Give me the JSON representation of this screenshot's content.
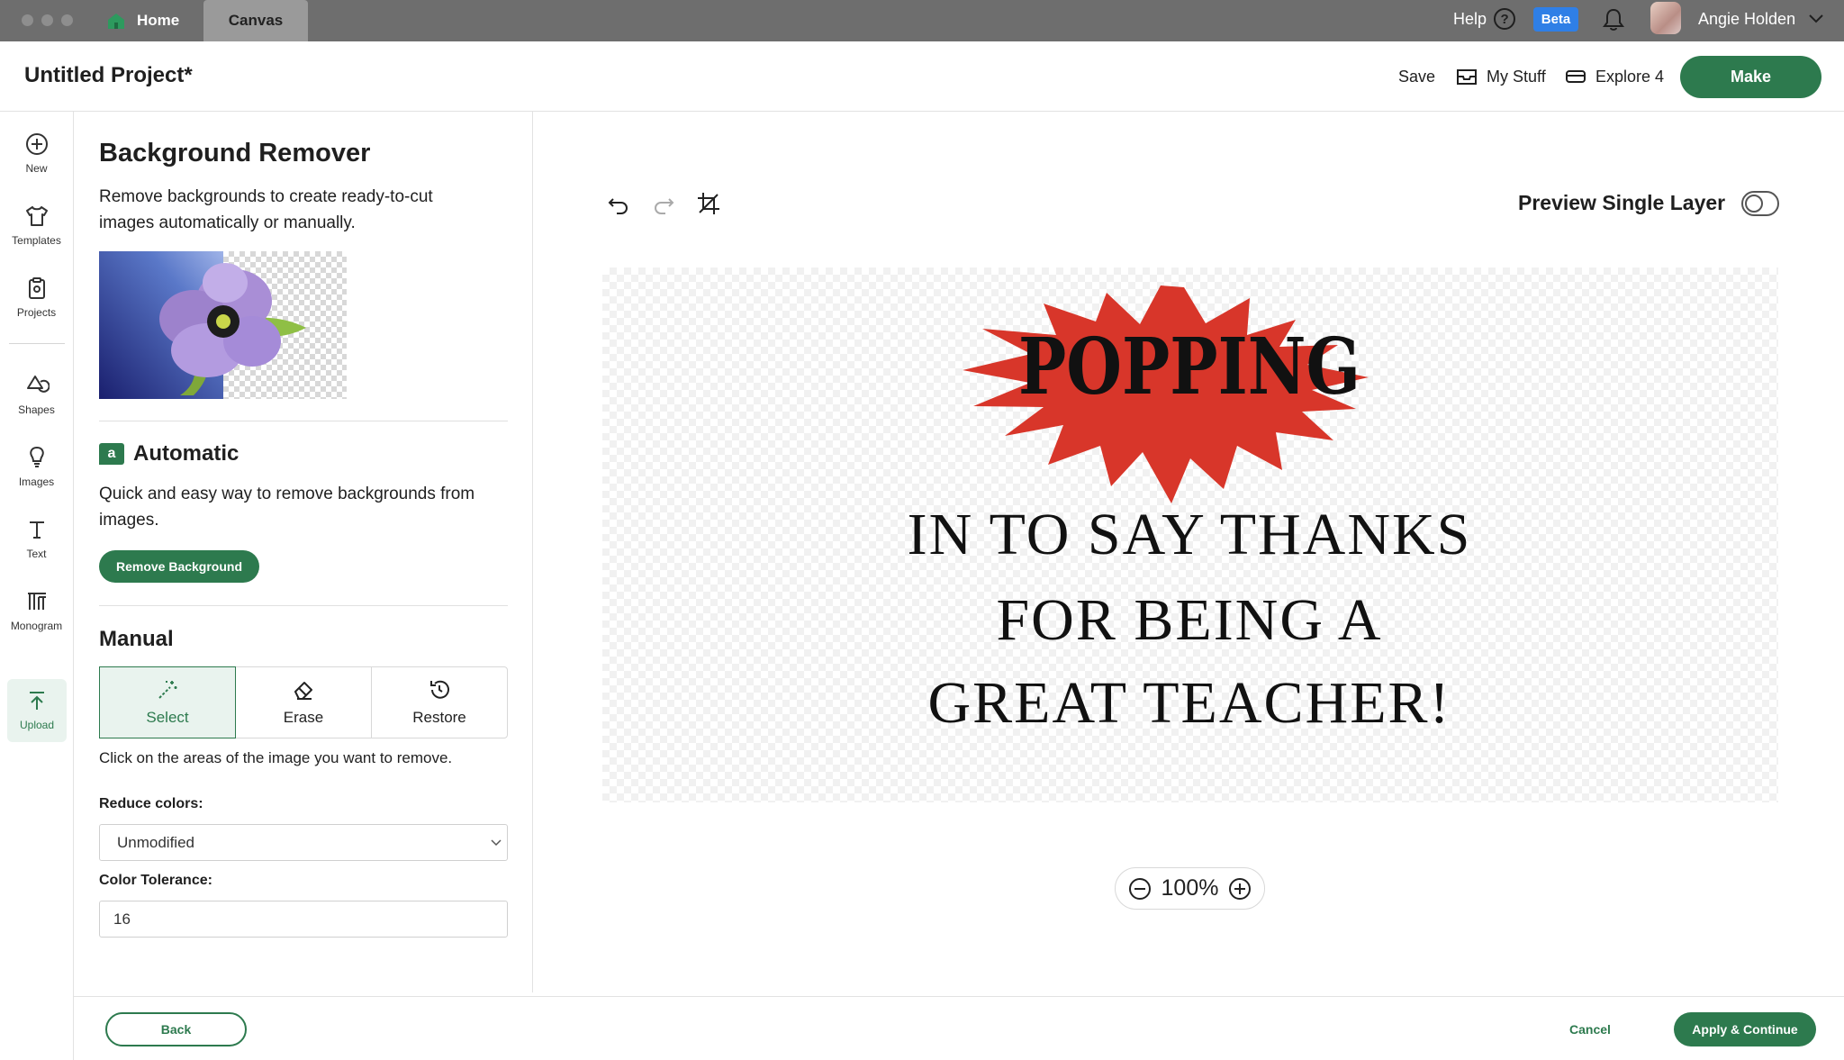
{
  "tabs": {
    "home": "Home",
    "canvas": "Canvas"
  },
  "topbar": {
    "help": "Help",
    "beta": "Beta",
    "user_name": "Angie Holden"
  },
  "header": {
    "project_title": "Untitled Project*",
    "save": "Save",
    "my_stuff": "My Stuff",
    "explore": "Explore 4",
    "make": "Make"
  },
  "rail": {
    "new": "New",
    "templates": "Templates",
    "projects": "Projects",
    "shapes": "Shapes",
    "images": "Images",
    "text": "Text",
    "monogram": "Monogram",
    "upload": "Upload"
  },
  "panel": {
    "title": "Background Remover",
    "description": "Remove backgrounds to create ready-to-cut images automatically or manually.",
    "automatic": {
      "heading": "Automatic",
      "description": "Quick and easy way to remove backgrounds from images.",
      "button": "Remove Background"
    },
    "manual": {
      "heading": "Manual",
      "tools": [
        "Select",
        "Erase",
        "Restore"
      ],
      "active_tool": "Select",
      "hint": "Click on the areas of the image you want to remove."
    },
    "reduce_colors": {
      "label": "Reduce colors:",
      "value": "Unmodified"
    },
    "color_tolerance": {
      "label": "Color Tolerance:",
      "value": "16"
    }
  },
  "canvas": {
    "preview_label": "Preview Single Layer",
    "preview_enabled": false,
    "image_text": {
      "headline": "POPPING",
      "line1": "IN TO SAY THANKS",
      "line2": "FOR BEING A",
      "line3": "GREAT TEACHER!"
    },
    "zoom": "100%"
  },
  "footer": {
    "back": "Back",
    "cancel": "Cancel",
    "apply": "Apply & Continue"
  },
  "colors": {
    "brand_green": "#2d7a4e",
    "beta_blue": "#2f7fe6",
    "burst_red": "#d8362a"
  }
}
